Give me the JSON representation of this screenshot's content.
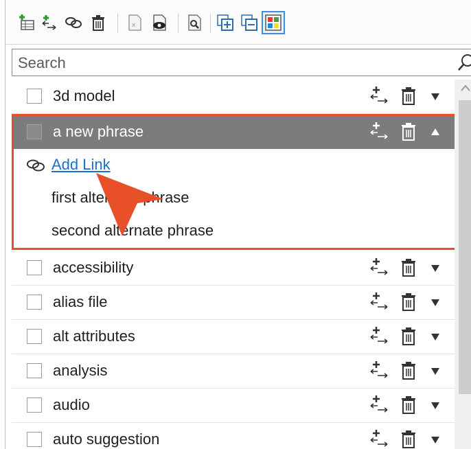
{
  "toolbar": {
    "buttons": [
      {
        "name": "add-phrase-button",
        "icon": "add-table-icon"
      },
      {
        "name": "add-synonym-button",
        "icon": "add-synonym-icon"
      },
      {
        "name": "link-button",
        "icon": "link-icon"
      },
      {
        "name": "delete-button",
        "icon": "trash-icon"
      },
      {
        "name": "document-button",
        "icon": "document-icon"
      },
      {
        "name": "preview-button",
        "icon": "eye-icon"
      },
      {
        "name": "settings-button",
        "icon": "tool-page-icon"
      },
      {
        "name": "expand-all-button",
        "icon": "expand-all-icon"
      },
      {
        "name": "collapse-all-button",
        "icon": "collapse-all-icon"
      },
      {
        "name": "color-view-button",
        "icon": "color-grid-icon"
      }
    ]
  },
  "search": {
    "placeholder": "Search",
    "value": ""
  },
  "list": {
    "rows_before": [
      {
        "label": "3d model"
      }
    ],
    "expanded": {
      "label": "a new phrase",
      "add_link": "Add Link",
      "alternates": [
        "first alternate phrase",
        "second alternate phrase"
      ]
    },
    "rows_after": [
      {
        "label": "accessibility"
      },
      {
        "label": "alias file"
      },
      {
        "label": "alt attributes"
      },
      {
        "label": "analysis"
      },
      {
        "label": "audio"
      },
      {
        "label": "auto suggestion"
      }
    ]
  },
  "colors": {
    "highlight_border": "#e4502a",
    "selected_row": "#7c7c7c",
    "link": "#1a6fd1",
    "annotation_arrow": "#e8502a"
  }
}
